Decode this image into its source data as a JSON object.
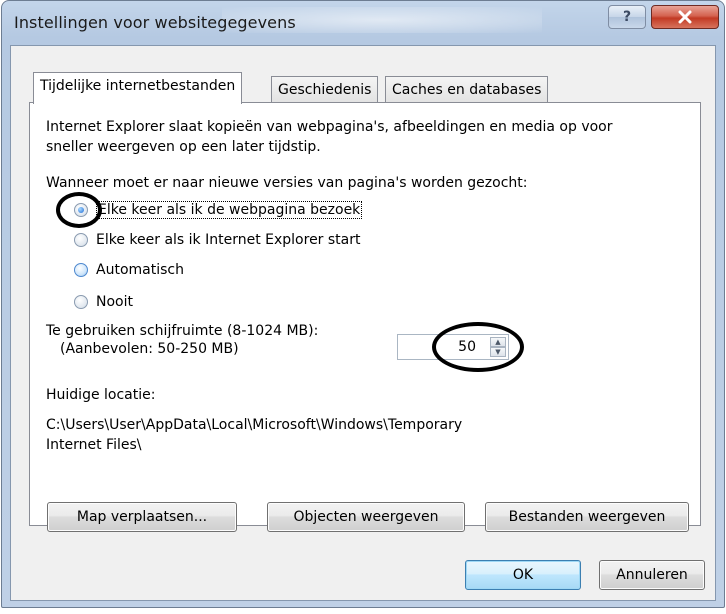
{
  "window": {
    "title": "Instellingen voor websitegegevens",
    "help_label": "?",
    "close_label": "x"
  },
  "tabs": [
    {
      "label": "Tijdelijke internetbestanden",
      "active": true
    },
    {
      "label": "Geschiedenis",
      "active": false
    },
    {
      "label": "Caches en databases",
      "active": false
    }
  ],
  "panel": {
    "description_line1": "Internet Explorer slaat kopieën van webpagina's, afbeeldingen en media op voor",
    "description_line2": "sneller weergeven op een later tijdstip.",
    "check_question": "Wanneer moet er naar nieuwe versies van pagina's worden gezocht:",
    "radio_options": [
      {
        "label": "Elke keer als ik de webpagina bezoek",
        "checked": true
      },
      {
        "label": "Elke keer als ik Internet Explorer start",
        "checked": false
      },
      {
        "label": "Automatisch",
        "checked": false
      },
      {
        "label": "Nooit",
        "checked": false
      }
    ],
    "disk_space_label": "Te gebruiken schijfruimte (8-1024 MB):",
    "disk_space_recommended": "(Aanbevolen: 50-250 MB)",
    "disk_space_value": "50",
    "current_location_label": "Huidige locatie:",
    "current_location_line1": "C:\\Users\\User\\AppData\\Local\\Microsoft\\Windows\\Temporary",
    "current_location_line2": "Internet Files\\",
    "buttons": {
      "move_folder": "Map verplaatsen...",
      "view_objects": "Objecten weergeven",
      "view_files": "Bestanden weergeven"
    }
  },
  "footer": {
    "ok": "OK",
    "cancel": "Annuleren"
  },
  "colors": {
    "titlebar": "#bfd0e6",
    "close_button": "#c23a24",
    "default_button_border": "#3c7fb1",
    "annotation": "#000000"
  }
}
